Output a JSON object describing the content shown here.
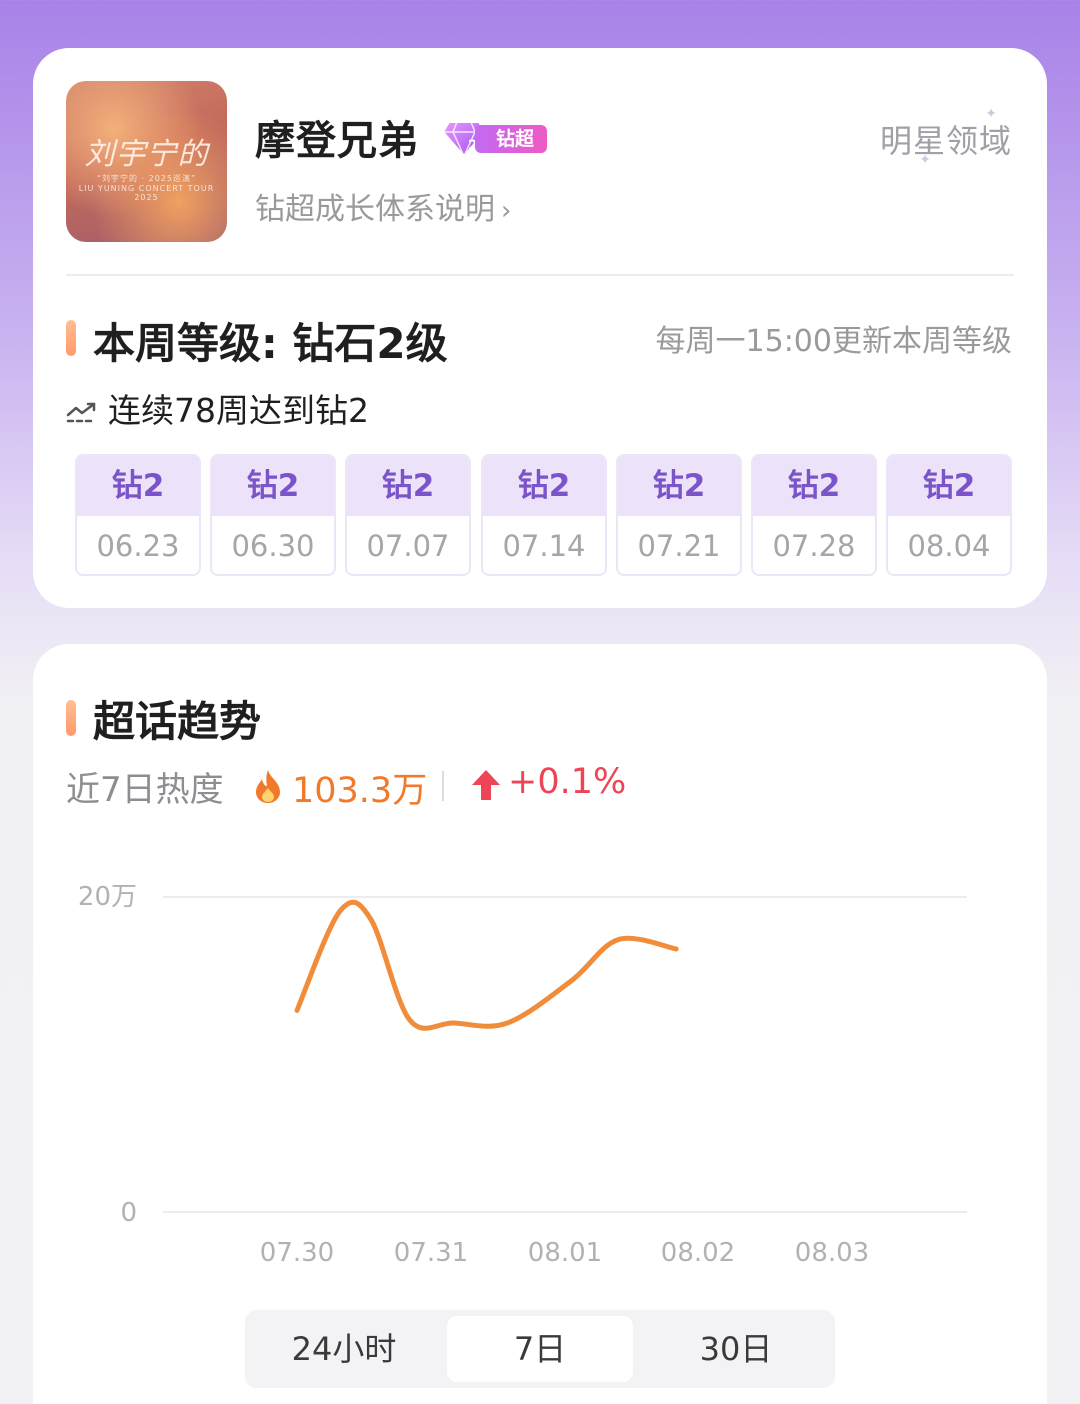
{
  "club": {
    "avatar_title": "刘宇宁的",
    "avatar_sub1": "“刘宇宁的 · 2025巡演”",
    "avatar_sub2": "LIU YUNING CONCERT TOUR 2025",
    "name": "摩登兄弟",
    "badge_label": "钻超",
    "badge_level": "2",
    "growth_link": "钻超成长体系说明",
    "domain": "明星领域"
  },
  "level": {
    "title": "本周等级: 钻石2级",
    "update_note": "每周一15:00更新本周等级",
    "streak_text": "连续78周达到钻2",
    "weeks": [
      {
        "level": "钻2",
        "date": "06.23"
      },
      {
        "level": "钻2",
        "date": "06.30"
      },
      {
        "level": "钻2",
        "date": "07.07"
      },
      {
        "level": "钻2",
        "date": "07.14"
      },
      {
        "level": "钻2",
        "date": "07.21"
      },
      {
        "level": "钻2",
        "date": "07.28"
      },
      {
        "level": "钻2",
        "date": "08.04"
      }
    ]
  },
  "trend": {
    "title": "超话趋势",
    "heat_label": "近7日热度",
    "heat_value": "103.3万",
    "heat_change": "+0.1%",
    "range_tabs": [
      {
        "label": "24小时",
        "active": false
      },
      {
        "label": "7日",
        "active": true
      },
      {
        "label": "30日",
        "active": false
      }
    ]
  },
  "colors": {
    "accent_orange": "#f08c3a",
    "level_purple": "#7a54c8",
    "up_red": "#ee4455"
  },
  "chart_data": {
    "type": "line",
    "y_tick_labels": [
      "20万",
      "0"
    ],
    "ylim": [
      0,
      200000
    ],
    "x_tick_labels": [
      "07.30",
      "07.31",
      "08.01",
      "08.02",
      "08.03"
    ],
    "grid": true,
    "series": [
      {
        "color": "#f08c3a",
        "x": [
          7.3,
          7.62,
          7.85,
          8.14,
          8.47,
          8.87,
          9.35,
          9.7,
          10.13
        ],
        "y": [
          128000,
          191000,
          186000,
          122000,
          120000,
          120000,
          147000,
          173000,
          167000
        ]
      }
    ]
  }
}
